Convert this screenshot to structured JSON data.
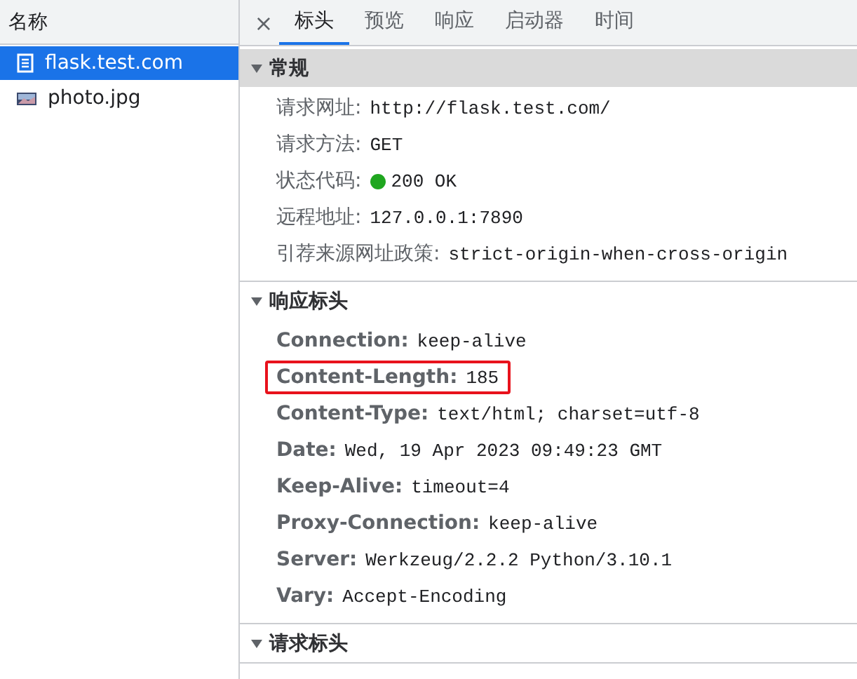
{
  "sidebar": {
    "header": "名称",
    "items": [
      {
        "name": "flask.test.com",
        "kind": "document",
        "selected": true
      },
      {
        "name": "photo.jpg",
        "kind": "image",
        "selected": false
      }
    ]
  },
  "tabs_bar": {
    "close": "×",
    "tabs": [
      {
        "label": "标头",
        "selected": true
      },
      {
        "label": "预览",
        "selected": false
      },
      {
        "label": "响应",
        "selected": false
      },
      {
        "label": "启动器",
        "selected": false
      },
      {
        "label": "时间",
        "selected": false
      }
    ]
  },
  "sections": [
    {
      "title": "常规",
      "kind": "general",
      "expanded": true,
      "rows": [
        {
          "key": "请求网址:",
          "value": "http://flask.test.com/",
          "highlighted": false
        },
        {
          "key": "请求方法:",
          "value": "GET",
          "highlighted": false
        },
        {
          "key": "状态代码:",
          "value": "200 OK",
          "color": "#1fa61f",
          "highlighted": false
        },
        {
          "key": "远程地址:",
          "value": "127.0.0.1:7890",
          "highlighted": false
        },
        {
          "key": "引荐来源网址政策:",
          "value": "strict-origin-when-cross-origin",
          "highlighted": false
        }
      ]
    },
    {
      "title": "响应标头",
      "kind": "headers",
      "expanded": true,
      "rows": [
        {
          "key": "Connection:",
          "value": "keep-alive",
          "highlighted": false
        },
        {
          "key": "Content-Length:",
          "value": "185",
          "highlighted": true
        },
        {
          "key": "Content-Type:",
          "value": "text/html; charset=utf-8",
          "highlighted": false
        },
        {
          "key": "Date:",
          "value": "Wed, 19 Apr 2023 09:49:23 GMT",
          "highlighted": false
        },
        {
          "key": "Keep-Alive:",
          "value": "timeout=4",
          "highlighted": false
        },
        {
          "key": "Proxy-Connection:",
          "value": "keep-alive",
          "highlighted": false
        },
        {
          "key": "Server:",
          "value": "Werkzeug/2.2.2 Python/3.10.1",
          "highlighted": false
        },
        {
          "key": "Vary:",
          "value": "Accept-Encoding",
          "highlighted": false
        }
      ]
    },
    {
      "title": "请求标头",
      "kind": "headers",
      "expanded": true
    }
  ]
}
